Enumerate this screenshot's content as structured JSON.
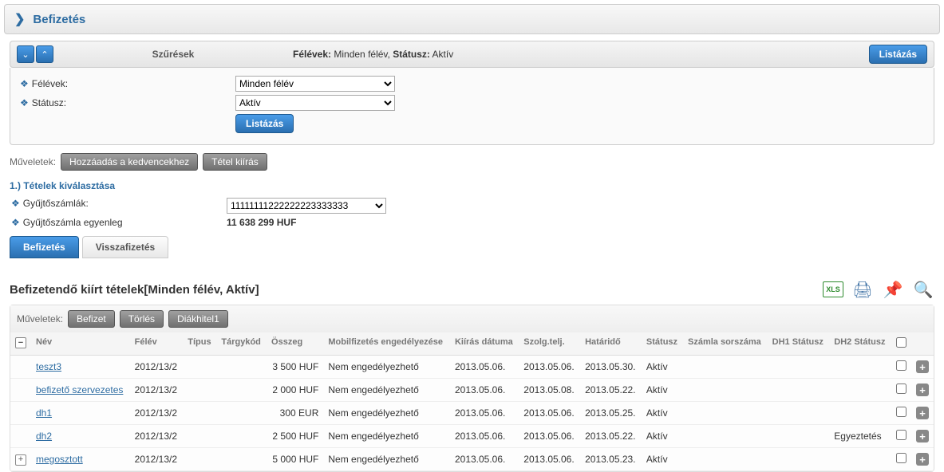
{
  "titlebar": {
    "text": "Befizetés"
  },
  "filter": {
    "heading": "Szűrések",
    "summary_semesters_label": "Félévek:",
    "summary_semesters_value": "Minden félév",
    "summary_status_label": "Státusz:",
    "summary_status_value": "Aktív",
    "list_btn": "Listázás",
    "rows": {
      "semesters_label": "Félévek:",
      "semesters_value": "Minden félév",
      "status_label": "Státusz:",
      "status_value": "Aktív"
    },
    "inner_list_btn": "Listázás"
  },
  "ops": {
    "label": "Műveletek:",
    "fav_btn": "Hozzáadás a kedvencekhez",
    "item_btn": "Tétel kiírás"
  },
  "section1": {
    "heading": "1.) Tételek kiválasztása",
    "accounts_label": "Gyűjtőszámlák:",
    "accounts_value": "11111111222222223333333",
    "balance_label": "Gyűjtőszámla egyenleg",
    "balance_value": "11 638 299 HUF"
  },
  "tabs": {
    "pay": "Befizetés",
    "refund": "Visszafizetés"
  },
  "table": {
    "title": "Befizetendő kiírt tételek[Minden félév, Aktív]",
    "ops_label": "Műveletek:",
    "btn_pay": "Befizet",
    "btn_del": "Törlés",
    "btn_loan": "Diákhitel1",
    "cols": {
      "name": "Név",
      "semester": "Félév",
      "type": "Típus",
      "subjcode": "Tárgykód",
      "amount": "Összeg",
      "mobile": "Mobilfizetés engedélyezése",
      "issued": "Kiírás dátuma",
      "service": "Szolg.telj.",
      "deadline": "Határidő",
      "status": "Státusz",
      "invoice": "Számla sorszáma",
      "dh1": "DH1 Státusz",
      "dh2": "DH2 Státusz"
    },
    "rows": [
      {
        "name": "teszt3",
        "semester": "2012/13/2",
        "type": "",
        "subjcode": "",
        "amount": "3 500 HUF",
        "mobile": "Nem engedélyezhető",
        "issued": "2013.05.06.",
        "service": "2013.05.06.",
        "deadline": "2013.05.30.",
        "status": "Aktív",
        "invoice": "",
        "dh1": "",
        "dh2": ""
      },
      {
        "name": "befizető szervezetes",
        "semester": "2012/13/2",
        "type": "",
        "subjcode": "",
        "amount": "2 000 HUF",
        "mobile": "Nem engedélyezhető",
        "issued": "2013.05.06.",
        "service": "2013.05.08.",
        "deadline": "2013.05.22.",
        "status": "Aktív",
        "invoice": "",
        "dh1": "",
        "dh2": ""
      },
      {
        "name": "dh1",
        "semester": "2012/13/2",
        "type": "",
        "subjcode": "",
        "amount": "300 EUR",
        "mobile": "Nem engedélyezhető",
        "issued": "2013.05.06.",
        "service": "2013.05.06.",
        "deadline": "2013.05.25.",
        "status": "Aktív",
        "invoice": "",
        "dh1": "",
        "dh2": ""
      },
      {
        "name": "dh2",
        "semester": "2012/13/2",
        "type": "",
        "subjcode": "",
        "amount": "2 500 HUF",
        "mobile": "Nem engedélyezhető",
        "issued": "2013.05.06.",
        "service": "2013.05.06.",
        "deadline": "2013.05.22.",
        "status": "Aktív",
        "invoice": "",
        "dh1": "",
        "dh2": "Egyeztetés"
      },
      {
        "name": "megosztott",
        "semester": "2012/13/2",
        "type": "",
        "subjcode": "",
        "amount": "5 000 HUF",
        "mobile": "Nem engedélyezhető",
        "issued": "2013.05.06.",
        "service": "2013.05.06.",
        "deadline": "2013.05.23.",
        "status": "Aktív",
        "invoice": "",
        "dh1": "",
        "dh2": ""
      }
    ]
  }
}
